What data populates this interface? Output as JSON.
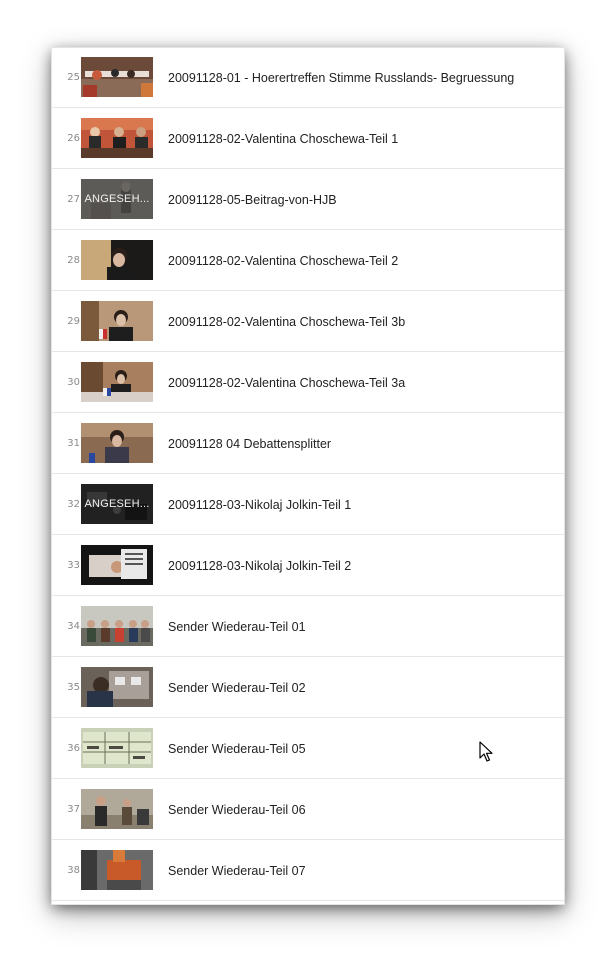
{
  "playlist": {
    "items": [
      {
        "index": "25",
        "title": "20091128-01 - Hoerertreffen Stimme Russlands- Begruessung",
        "watched": false,
        "thumb": "meeting-panel"
      },
      {
        "index": "26",
        "title": "20091128-02-Valentina Choschewa-Teil 1",
        "watched": false,
        "thumb": "panel-red"
      },
      {
        "index": "27",
        "title": "20091128-05-Beitrag-von-HJB",
        "watched": true,
        "thumb": "speaker-light"
      },
      {
        "index": "28",
        "title": "20091128-02-Valentina Choschewa-Teil 2",
        "watched": false,
        "thumb": "woman-closeup"
      },
      {
        "index": "29",
        "title": "20091128-02-Valentina Choschewa-Teil 3b",
        "watched": false,
        "thumb": "woman-flags"
      },
      {
        "index": "30",
        "title": "20091128-02-Valentina Choschewa-Teil 3a",
        "watched": false,
        "thumb": "woman-table"
      },
      {
        "index": "31",
        "title": "20091128 04 Debattensplitter",
        "watched": false,
        "thumb": "debate"
      },
      {
        "index": "32",
        "title": "20091128-03-Nikolaj Jolkin-Teil 1",
        "watched": true,
        "thumb": "dark-room"
      },
      {
        "index": "33",
        "title": "20091128-03-Nikolaj Jolkin-Teil 2",
        "watched": false,
        "thumb": "reading"
      },
      {
        "index": "34",
        "title": "Sender Wiederau-Teil 01",
        "watched": false,
        "thumb": "group-outdoor"
      },
      {
        "index": "35",
        "title": "Sender Wiederau-Teil 02",
        "watched": false,
        "thumb": "indoor-equipment"
      },
      {
        "index": "36",
        "title": "Sender Wiederau-Teil 05",
        "watched": false,
        "thumb": "sign-board"
      },
      {
        "index": "37",
        "title": "Sender Wiederau-Teil 06",
        "watched": false,
        "thumb": "people-room"
      },
      {
        "index": "38",
        "title": "Sender Wiederau-Teil 07",
        "watched": false,
        "thumb": "machinery"
      }
    ],
    "watched_label": "ANGESEH..."
  },
  "cursor": {
    "icon": "mouse-pointer-icon"
  }
}
